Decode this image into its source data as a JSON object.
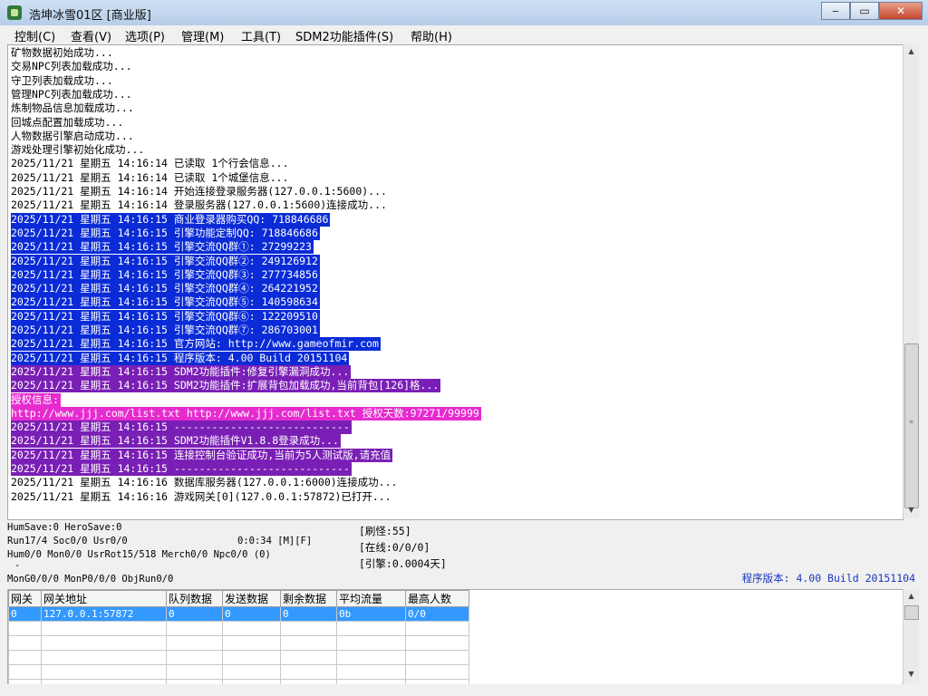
{
  "window": {
    "title": "浩坤冰雪01区 [商业版]",
    "minimize": "‒",
    "maximize": "▭",
    "close": "✕"
  },
  "menu": [
    "控制(C)",
    "查看(V)",
    "选项(P)",
    "管理(M)",
    "工具(T)",
    "SDM2功能插件(S)",
    "帮助(H)"
  ],
  "log": [
    {
      "text": "矿物数据初始成功...",
      "style": ""
    },
    {
      "text": "交易NPC列表加载成功...",
      "style": ""
    },
    {
      "text": "守卫列表加载成功...",
      "style": ""
    },
    {
      "text": "管理NPC列表加载成功...",
      "style": ""
    },
    {
      "text": "炼制物品信息加载成功...",
      "style": ""
    },
    {
      "text": "回城点配置加载成功...",
      "style": ""
    },
    {
      "text": "人物数据引擎启动成功...",
      "style": ""
    },
    {
      "text": "游戏处理引擎初始化成功...",
      "style": ""
    },
    {
      "text": "2025/11/21 星期五 14:16:14 已读取 1个行会信息...",
      "style": ""
    },
    {
      "text": "2025/11/21 星期五 14:16:14 已读取 1个城堡信息...",
      "style": ""
    },
    {
      "text": "2025/11/21 星期五 14:16:14 开始连接登录服务器(127.0.0.1:5600)...",
      "style": ""
    },
    {
      "text": "2025/11/21 星期五 14:16:14 登录服务器(127.0.0.1:5600)连接成功...",
      "style": ""
    },
    {
      "text": "2025/11/21 星期五 14:16:15 商业登录器购买QQ: 718846686",
      "style": "blue"
    },
    {
      "text": "2025/11/21 星期五 14:16:15 引擎功能定制QQ: 718846686",
      "style": "blue"
    },
    {
      "text": "2025/11/21 星期五 14:16:15 引擎交流QQ群①: 27299223",
      "style": "blue"
    },
    {
      "text": "2025/11/21 星期五 14:16:15 引擎交流QQ群②: 249126912",
      "style": "blue"
    },
    {
      "text": "2025/11/21 星期五 14:16:15 引擎交流QQ群③: 277734856",
      "style": "blue"
    },
    {
      "text": "2025/11/21 星期五 14:16:15 引擎交流QQ群④: 264221952",
      "style": "blue"
    },
    {
      "text": "2025/11/21 星期五 14:16:15 引擎交流QQ群⑤: 140598634",
      "style": "blue"
    },
    {
      "text": "2025/11/21 星期五 14:16:15 引擎交流QQ群⑥: 122209510",
      "style": "blue"
    },
    {
      "text": "2025/11/21 星期五 14:16:15 引擎交流QQ群⑦: 286703001",
      "style": "blue"
    },
    {
      "text": "2025/11/21 星期五 14:16:15 官方网站: http://www.gameofmir.com",
      "style": "blue"
    },
    {
      "text": "2025/11/21 星期五 14:16:15 程序版本: 4.00 Build 20151104",
      "style": "blue"
    },
    {
      "text": "2025/11/21 星期五 14:16:15 SDM2功能插件:修复引擎漏洞成功...",
      "style": "purple"
    },
    {
      "text": "2025/11/21 星期五 14:16:15 SDM2功能插件:扩展背包加载成功,当前背包[126]格...",
      "style": "purple"
    },
    {
      "text": "授权信息:",
      "style": "pink"
    },
    {
      "text": "http://www.jjj.com/list.txt http://www.jjj.com/list.txt 授权天数:97271/99999",
      "style": "pink"
    },
    {
      "text": "2025/11/21 星期五 14:16:15 ----------------------------",
      "style": "purple"
    },
    {
      "text": "2025/11/21 星期五 14:16:15 SDM2功能插件V1.8.8登录成功...",
      "style": "purple"
    },
    {
      "text": "2025/11/21 星期五 14:16:15 连接控制台验证成功,当前为5人测试版,请充值",
      "style": "purple"
    },
    {
      "text": "2025/11/21 星期五 14:16:15 ----------------------------",
      "style": "purple"
    },
    {
      "text": "2025/11/21 星期五 14:16:16 数据库服务器(127.0.0.1:6000)连接成功...",
      "style": ""
    },
    {
      "text": "2025/11/21 星期五 14:16:16 游戏网关[0](127.0.0.1:57872)已打开...",
      "style": ""
    }
  ],
  "status": {
    "line1": "HumSave:0 HeroSave:0",
    "line2": "Run17/4 Soc0/0 Usr0/0",
    "line2b": "0:0:34 [M][F]",
    "line3": "Hum0/0 Mon0/0 UsrRot15/518 Merch0/0 Npc0/0 (0)",
    "line4": "-",
    "line5": "MonG0/0/0 MonP0/0/0 ObjRun0/0",
    "refresh": "[刷怪:55]",
    "online": "[在线:0/0/0]",
    "engine": "[引擎:0.0004天]",
    "version": "程序版本: 4.00 Build 20151104"
  },
  "grid": {
    "headers": [
      "网关",
      "网关地址",
      "队列数据",
      "发送数据",
      "剩余数据",
      "平均流量",
      "最高人数"
    ],
    "rows": [
      [
        "0",
        "127.0.0.1:57872",
        "0",
        "0",
        "0",
        "0b",
        "0/0"
      ]
    ]
  }
}
